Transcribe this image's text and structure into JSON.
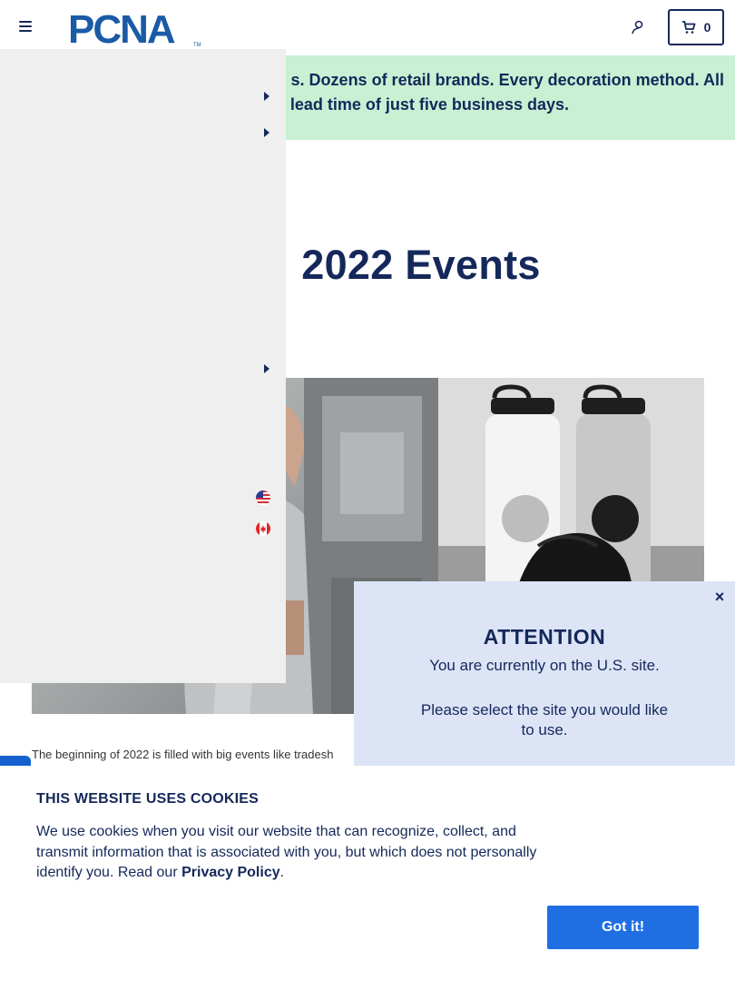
{
  "header": {
    "logo_text": "PCNA",
    "logo_tm": "TM",
    "cart_count": "0"
  },
  "promo": {
    "line1": "s. Dozens of retail brands. Every decoration method. All",
    "line2": "lead time of just five business days."
  },
  "page": {
    "title": "2022 Events",
    "intro": "The beginning of 2022 is filled with big events like tradesh"
  },
  "drawer": {
    "arrows": [
      "expand",
      "expand",
      "expand"
    ],
    "flags": [
      "us-flag",
      "canada-flag"
    ]
  },
  "attention": {
    "title": "ATTENTION",
    "line1": "You are currently on the U.S. site.",
    "line2": "Please select the site you would like to use.",
    "close_label": "×"
  },
  "cookie": {
    "title": "THIS WEBSITE USES COOKIES",
    "body": "We use cookies when you visit our website that can recognize, collect, and transmit information that is associated with you, but which does not personally identify you. Read our ",
    "link": "Privacy Policy",
    "tail": ".",
    "button": "Got it!"
  },
  "colors": {
    "navy": "#14285a",
    "promo_bg": "#c9f0d3",
    "drawer_bg": "#efefef",
    "attention_bg": "#dce4f6",
    "button_blue": "#1f6fe3"
  }
}
